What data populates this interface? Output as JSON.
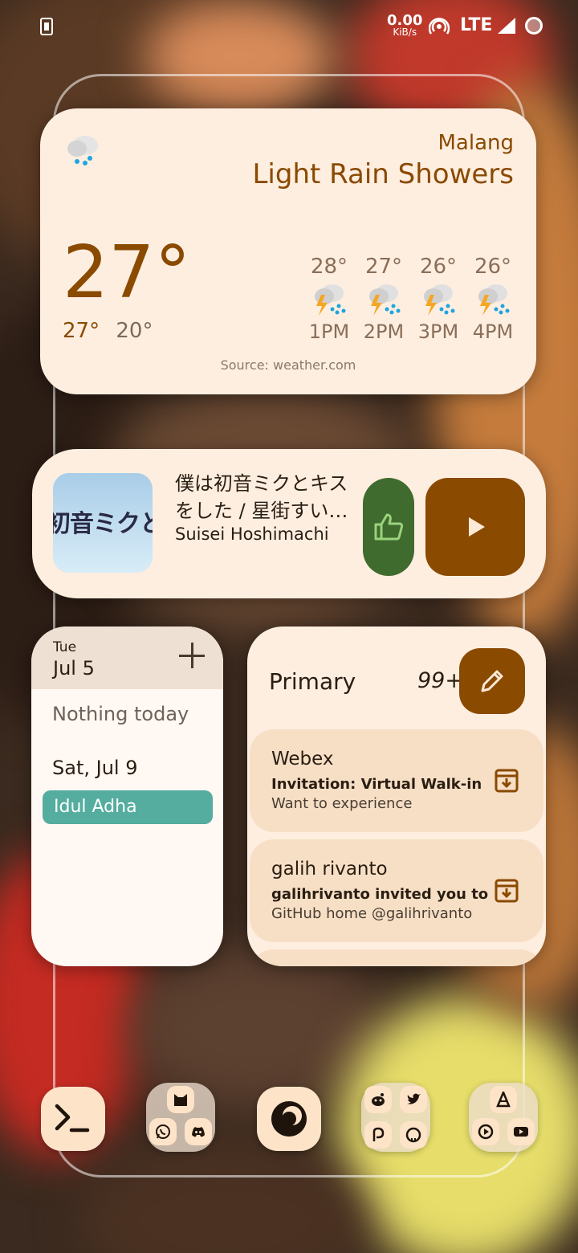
{
  "status_bar": {
    "net_speed_value": "0.00",
    "net_speed_unit": "KiB/s",
    "network": "LTE"
  },
  "weather": {
    "city": "Malang",
    "condition": "Light Rain Showers",
    "temperature": "27°",
    "high": "27°",
    "low": "20°",
    "forecast": [
      {
        "temp": "28°",
        "hour": "1PM"
      },
      {
        "temp": "27°",
        "hour": "2PM"
      },
      {
        "temp": "26°",
        "hour": "3PM"
      },
      {
        "temp": "26°",
        "hour": "4PM"
      }
    ],
    "source": "Source: weather.com",
    "icon": "rain-showers-icon"
  },
  "music": {
    "title": "僕は初音ミクとキスをした / 星街すい…",
    "artist": "Suisei Hoshimachi",
    "art_text": "初音ミクとキス"
  },
  "calendar": {
    "weekday": "Tue",
    "date": "Jul 5",
    "empty_text": "Nothing today",
    "next_date": "Sat, Jul 9",
    "event": "Idul Adha",
    "event_color": "#54ad9e"
  },
  "gmail": {
    "label": "Primary",
    "unread_count": "99+",
    "messages": [
      {
        "from": "Webex",
        "subject": "Invitation: Virtual Walk-in",
        "snippet": "Want to experience"
      },
      {
        "from": "galih rivanto",
        "subject": "galihrivanto invited you to",
        "snippet": "GitHub home @galihrivanto"
      }
    ]
  },
  "dock": {
    "apps": [
      "terminal-icon",
      "firefox-icon"
    ],
    "folders": [
      [
        "cat-app-icon",
        "whatsapp-icon",
        "discord-icon"
      ],
      [
        "reddit-icon",
        "twitter-icon",
        "patreon-icon",
        "github-icon"
      ],
      [
        "vlc-icon",
        "player-icon",
        "youtube-icon"
      ]
    ]
  },
  "colors": {
    "accent": "#8a4a00",
    "like_green": "#3f6b2e",
    "card_bg": "#fdeee0"
  }
}
